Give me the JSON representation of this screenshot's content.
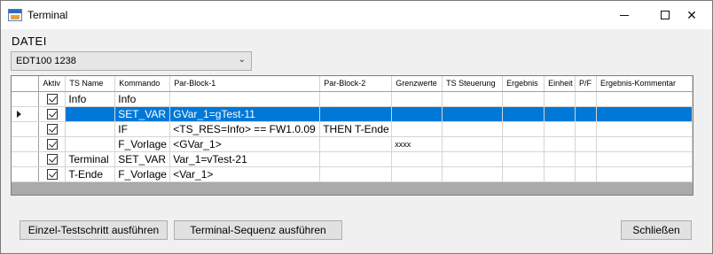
{
  "window": {
    "title": "Terminal",
    "minimize_glyph": "minimize-icon",
    "maximize_glyph": "maximize-icon",
    "close_glyph": "✕"
  },
  "menu": {
    "datei": "DATEI"
  },
  "combo": {
    "selected": "EDT100 1238"
  },
  "table": {
    "columns": [
      "Aktiv",
      "TS Name",
      "Kommando",
      "Par-Block-1",
      "Par-Block-2",
      "Grenzwerte",
      "TS Steuerung",
      "Ergebnis",
      "Einheit",
      "P/F",
      "Ergebnis-Kommentar"
    ],
    "rows": [
      {
        "aktiv": true,
        "ts_name": "Info",
        "kommando": "Info",
        "par1": "",
        "par2": "",
        "grenzwerte": ""
      },
      {
        "aktiv": true,
        "ts_name": "",
        "kommando": "SET_VAR",
        "par1": "GVar_1=gTest-11",
        "par2": "",
        "grenzwerte": "",
        "selected": true
      },
      {
        "aktiv": true,
        "ts_name": "",
        "kommando": "IF",
        "par1": "<TS_RES=Info> == FW1.0.09",
        "par2": "THEN T-Ende",
        "grenzwerte": ""
      },
      {
        "aktiv": true,
        "ts_name": "",
        "kommando": "F_Vorlage",
        "par1": "<GVar_1>",
        "par2": "",
        "grenzwerte": "xxxx"
      },
      {
        "aktiv": true,
        "ts_name": "Terminal",
        "kommando": "SET_VAR",
        "par1": "Var_1=vTest-21",
        "par2": "",
        "grenzwerte": ""
      },
      {
        "aktiv": true,
        "ts_name": "T-Ende",
        "kommando": "F_Vorlage",
        "par1": "<Var_1>",
        "par2": "",
        "grenzwerte": ""
      }
    ]
  },
  "buttons": {
    "einzel": "Einzel-Testschritt ausführen",
    "sequenz": "Terminal-Sequenz ausführen",
    "schliessen": "Schließen"
  }
}
